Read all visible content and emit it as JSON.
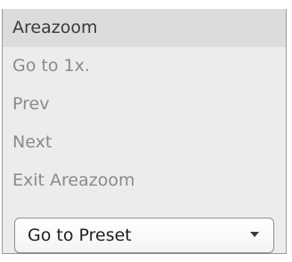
{
  "menu": {
    "items": [
      {
        "label": "Areazoom",
        "state": "active"
      },
      {
        "label": "Go to 1x.",
        "state": "disabled"
      },
      {
        "label": "Prev",
        "state": "disabled"
      },
      {
        "label": "Next",
        "state": "disabled"
      },
      {
        "label": "Exit Areazoom",
        "state": "disabled"
      }
    ]
  },
  "preset": {
    "selected_label": "Go to Preset",
    "icon": "chevron-down-icon"
  },
  "colors": {
    "panel_bg": "#ececec",
    "active_row_bg": "#dcdcdc",
    "disabled_text": "#8a8a8a",
    "active_text": "#3a3a3a"
  }
}
